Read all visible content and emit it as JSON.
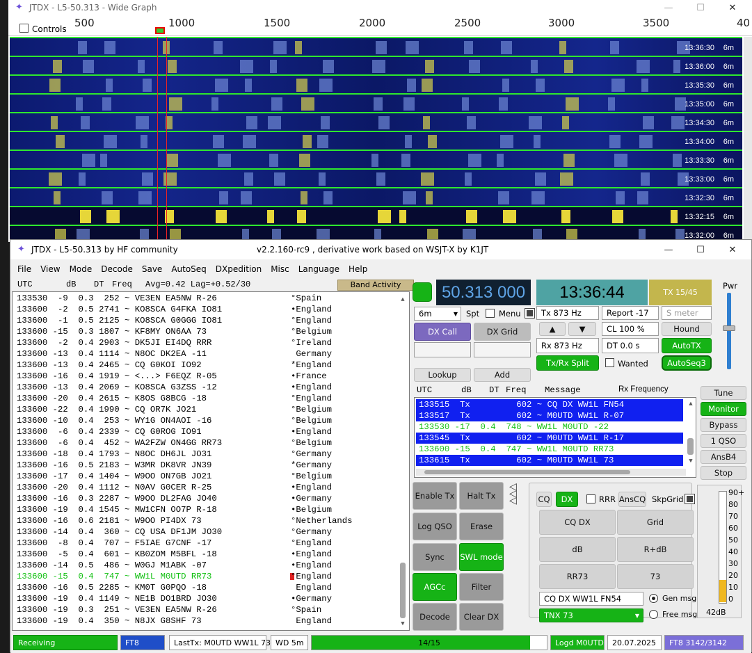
{
  "wide_graph": {
    "title": "JTDX - L5-50.313 - Wide Graph",
    "controls_label": "Controls",
    "scale_ticks": [
      "500",
      "1000",
      "1500",
      "2000",
      "2500",
      "3000",
      "3500",
      "40"
    ],
    "rows": [
      {
        "time": "13:36:30",
        "band": "6m"
      },
      {
        "time": "13:36:00",
        "band": "6m"
      },
      {
        "time": "13:35:30",
        "band": "6m"
      },
      {
        "time": "13:35:00",
        "band": "6m"
      },
      {
        "time": "13:34:30",
        "band": "6m"
      },
      {
        "time": "13:34:00",
        "band": "6m"
      },
      {
        "time": "13:33:30",
        "band": "6m"
      },
      {
        "time": "13:33:00",
        "band": "6m"
      },
      {
        "time": "13:32:30",
        "band": "6m"
      },
      {
        "time": "13:32:15",
        "band": "6m"
      },
      {
        "time": "13:32:00",
        "band": "6m"
      }
    ]
  },
  "main": {
    "title_left": "JTDX - L5-50.313  by HF community",
    "title_right": "v2.2.160-rc9 , derivative work based on WSJT-X by K1JT",
    "menu": [
      "File",
      "View",
      "Mode",
      "Decode",
      "Save",
      "AutoSeq",
      "DXpedition",
      "Misc",
      "Language",
      "Help"
    ],
    "band_header": {
      "utc": "UTC",
      "db": "dB",
      "dt": "DT",
      "freq": "Freq",
      "avg": "Avg=0.42 Lag=+0.52/30"
    },
    "band_activity_label": "Band Activity",
    "band_activity": [
      {
        "text": "133530  -9  0.3  252 ~ VE3EN EA5NW R-26",
        "country": "°Spain"
      },
      {
        "text": "133600  -2  0.5 2741 ~ KO8SCA G4FKA IO81",
        "country": "•England"
      },
      {
        "text": "133600  -1  0.5 2125 ~ KO8SCA G0GGG IO81",
        "country": "°England"
      },
      {
        "text": "133600 -15  0.3 1807 ~ KF8MY ON6AA 73",
        "country": "°Belgium"
      },
      {
        "text": "133600  -2  0.4 2903 ~ DK5JI EI4DQ RRR",
        "country": "°Ireland"
      },
      {
        "text": "133600 -13  0.4 1114 ~ N8OC DK2EA -11",
        "country": " Germany"
      },
      {
        "text": "133600 -13  0.4 2465 ~ CQ G0KOI IO92",
        "country": "*England"
      },
      {
        "text": "133600 -16  0.4 1919 ~ <...> F6EQZ R-05",
        "country": "•France"
      },
      {
        "text": "133600 -13  0.4 2069 ~ KO8SCA G3ZSS -12",
        "country": "•England"
      },
      {
        "text": "133600 -20  0.4 2615 ~ K8OS G8BCG -18",
        "country": "°England"
      },
      {
        "text": "133600 -22  0.4 1990 ~ CQ OR7K JO21",
        "country": "°Belgium"
      },
      {
        "text": "133600 -10  0.4  253 ~ WY1G ON4AOI -16",
        "country": "°Belgium"
      },
      {
        "text": "133600  -6  0.4 2339 ~ CQ G0ROG IO91",
        "country": "•England"
      },
      {
        "text": "133600  -6  0.4  452 ~ WA2FZW ON4GG RR73",
        "country": "°Belgium"
      },
      {
        "text": "133600 -18  0.4 1793 ~ N8OC DH6JL JO31",
        "country": "°Germany"
      },
      {
        "text": "133600 -16  0.5 2183 ~ W3MR DK8VR JN39",
        "country": "*Germany"
      },
      {
        "text": "133600 -17  0.4 1404 ~ W9OO ON7GB JO21",
        "country": "°Belgium"
      },
      {
        "text": "133600 -20  0.4 1112 ~ N0AV G0CER R-25",
        "country": "•England"
      },
      {
        "text": "133600 -16  0.3 2287 ~ W9OO DL2FAG JO40",
        "country": "•Germany"
      },
      {
        "text": "133600 -19  0.4 1545 ~ MW1CFN OO7P R-18",
        "country": "•Belgium"
      },
      {
        "text": "133600 -16  0.6 2181 ~ W9OO PI4DX 73",
        "country": "°Netherlands"
      },
      {
        "text": "133600 -14  0.4  360 ~ CQ USA DF1JM JO30",
        "country": "°Germany"
      },
      {
        "text": "133600  -8  0.4  707 ~ F5IAE G7CNF -17",
        "country": "°England"
      },
      {
        "text": "133600  -5  0.4  601 ~ KB0ZOM M5BFL -18",
        "country": "•England"
      },
      {
        "text": "133600 -14  0.5  486 ~ W0GJ M1ABK -07",
        "country": "•England"
      },
      {
        "text": "133600 -15  0.4  747 ~ WW1L M0UTD RR73",
        "country": "°England",
        "highlight": true
      },
      {
        "text": "133600 -16  0.5 2285 ~ KM0T G0PQO -18",
        "country": " England"
      },
      {
        "text": "133600 -19  0.4 1149 ~ NE1B DO1BRD JO30",
        "country": "•Germany"
      },
      {
        "text": "133600 -19  0.3  251 ~ VE3EN EA5NW R-26",
        "country": "°Spain"
      },
      {
        "text": "133600 -19  0.4  350 ~ N8JX G8SHF 73",
        "country": " England"
      }
    ],
    "frequency": "50.313 000",
    "clock": "13:36:44",
    "tx_counter": "TX 15/45",
    "pwr_label": "Pwr",
    "band_select": "6m",
    "spt_label": "Spt",
    "menu_label": "Menu",
    "dx_call_label": "DX Call",
    "dx_grid_label": "DX Grid",
    "lookup_label": "Lookup",
    "add_label": "Add",
    "tx_hz": "Tx  873  Hz",
    "rx_hz": "Rx  873  Hz",
    "report": "Report -17",
    "s_meter_placeholder": "S meter",
    "cl": "CL  100 %",
    "dt": "DT 0.0 s",
    "hound_label": "Hound",
    "autotx_label": "AutoTX",
    "txrx_split_label": "Tx/Rx Split",
    "wanted_label": "Wanted",
    "autoseq_label": "AutoSeq3",
    "up_arrow": "▲",
    "down_arrow": "▼",
    "rx_header": {
      "utc": "UTC",
      "db": "dB",
      "dt": "DT",
      "freq": "Freq",
      "msg": "Message",
      "rxf": "Rx Frequency"
    },
    "rx_rows": [
      {
        "text": "133515  Tx         602 ~ CQ DX WW1L FN54",
        "style": "blue"
      },
      {
        "text": "133517  Tx         602 ~ M0UTD WW1L R-07",
        "style": "blue"
      },
      {
        "text": "133530 -17  0.4  748 ~ WW1L M0UTD -22",
        "style": "grn"
      },
      {
        "text": "133545  Tx         602 ~ M0UTD WW1L R-17",
        "style": "blue"
      },
      {
        "text": "133600 -15  0.4  747 ~ WW1L M0UTD RR73",
        "style": "grn"
      },
      {
        "text": "133615  Tx         602 ~ M0UTD WW1L 73",
        "style": "blue"
      }
    ],
    "side_buttons": [
      "Tune",
      "Monitor",
      "Bypass",
      "1 QSO",
      "AnsB4",
      "Stop"
    ],
    "action_buttons": {
      "enable_tx": "Enable Tx",
      "halt_tx": "Halt Tx",
      "log_qso": "Log QSO",
      "erase": "Erase",
      "sync": "Sync",
      "swl_mode": "SWL mode",
      "agcc": "AGCc",
      "filter": "Filter",
      "decode": "Decode",
      "clear_dx": "Clear DX"
    },
    "tx_panel": {
      "cq": "CQ",
      "dx": "DX",
      "rrr": "RRR",
      "anscq": "AnsCQ",
      "skpgrid": "SkpGrid",
      "cq_dx": "CQ DX",
      "grid": "Grid",
      "db": "dB",
      "r_db": "R+dB",
      "rr73": "RR73",
      "73": "73",
      "gen_msg_field": "CQ DX WW1L FN54",
      "tnx_msg": "TNX 73",
      "gen_msg_label": "Gen msg",
      "free_msg_label": "Free msg"
    },
    "meter": {
      "ticks": [
        "90+",
        "80",
        "70",
        "60",
        "50",
        "40",
        "30",
        "20",
        "10",
        "0"
      ],
      "level_db": "42dB",
      "level": 0.42
    },
    "status": {
      "receiving": "Receiving",
      "mode": "FT8",
      "last_tx": "LastTx: M0UTD WW1L 73",
      "wd": "WD 5m",
      "progress_text": "14/15",
      "progress": 0.93,
      "logged": "Logd M0UTD",
      "date": "20.07.2025",
      "counter": "FT8  3142/3142"
    }
  },
  "colors": {
    "accent_green": "#16b316",
    "tx_blue": "#1020f0",
    "freq_bg": "#102030",
    "clock_bg": "#4fa3a3",
    "tx_counter_bg": "#c3b64d"
  }
}
